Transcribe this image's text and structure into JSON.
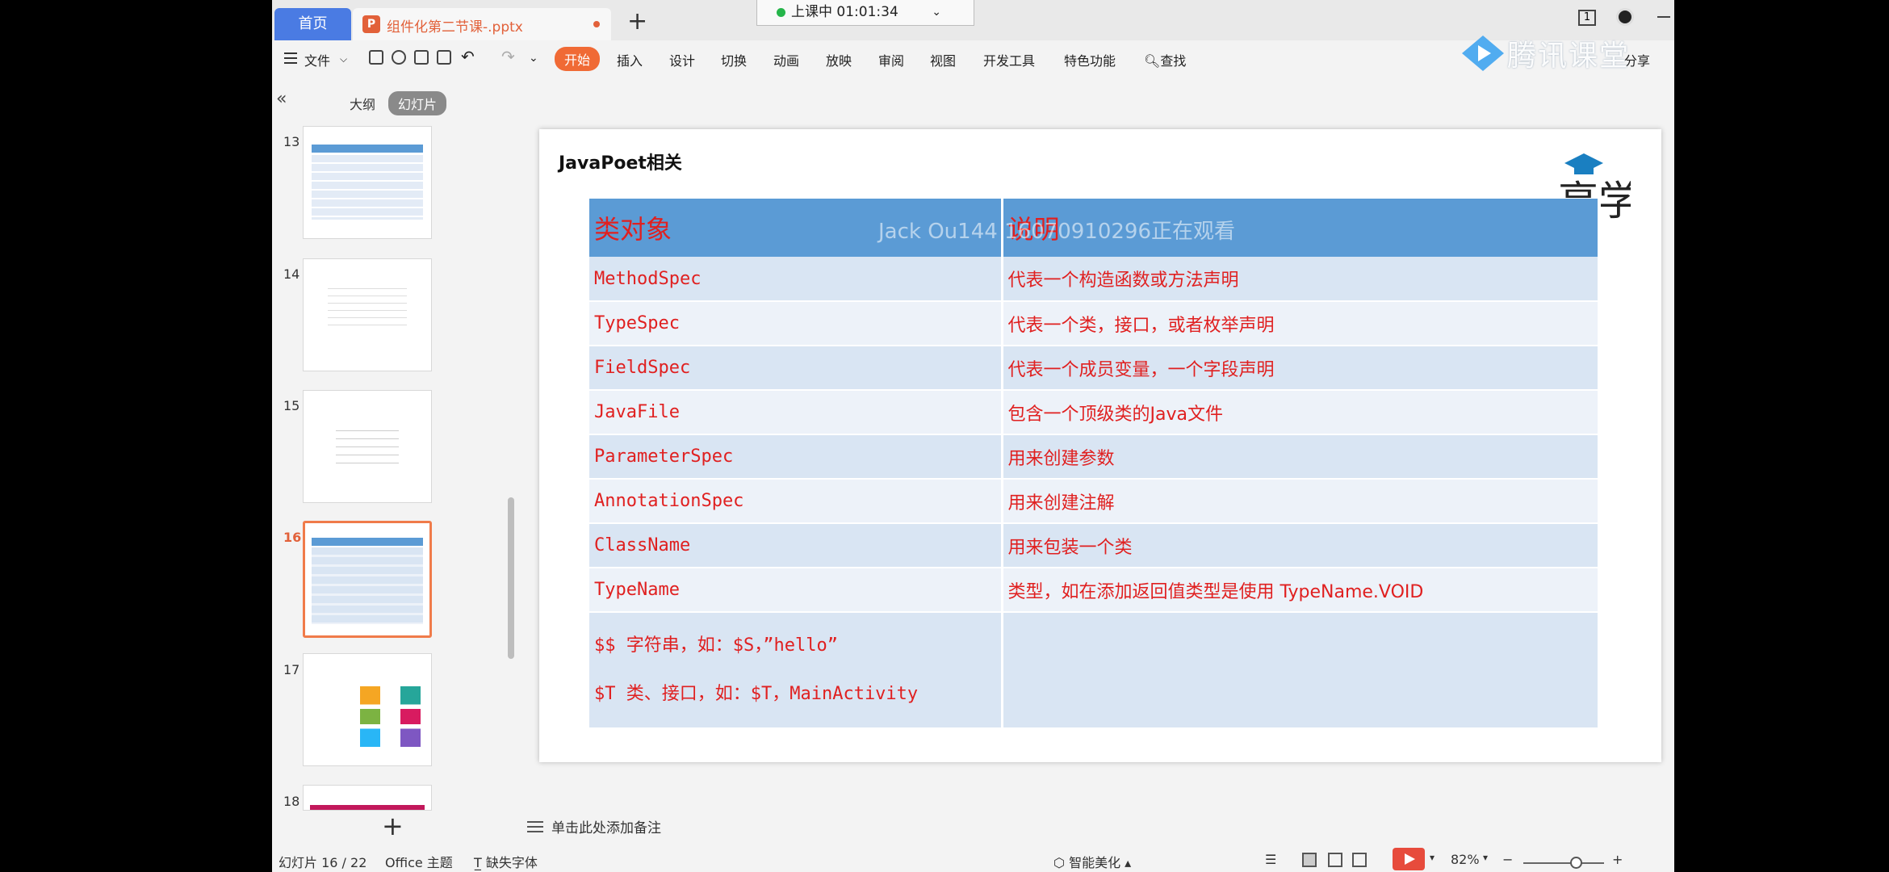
{
  "tabs": {
    "home": "首页",
    "document": "组件化第二节课-.pptx",
    "add": "+"
  },
  "live": {
    "status": "上课中 01:01:34",
    "chevron": "⌄"
  },
  "window": {
    "badge": "1"
  },
  "menu": {
    "file": "文件",
    "items": [
      "开始",
      "插入",
      "设计",
      "切换",
      "动画",
      "放映",
      "审阅",
      "视图",
      "开发工具",
      "特色功能"
    ],
    "search": "查找",
    "share": "分享",
    "watermark": "腾讯课堂"
  },
  "sidebar": {
    "outline": "大纲",
    "slides": "幻灯片",
    "thumbs": [
      "13",
      "14",
      "15",
      "16",
      "17",
      "18"
    ],
    "current": "16"
  },
  "slide": {
    "title": "JavaPoet相关",
    "viewer_watermark": "Jack Ou144   16070910296正在观看",
    "table": {
      "headers": [
        "类对象",
        "说明"
      ],
      "rows": [
        [
          "MethodSpec",
          "代表一个构造函数或方法声明"
        ],
        [
          "TypeSpec",
          "代表一个类，接口，或者枚举声明"
        ],
        [
          "FieldSpec",
          "代表一个成员变量，一个字段声明"
        ],
        [
          "JavaFile",
          "包含一个顶级类的Java文件"
        ],
        [
          "ParameterSpec",
          "用来创建参数"
        ],
        [
          "AnnotationSpec",
          "用来创建注解"
        ],
        [
          "ClassName",
          "用来包装一个类"
        ],
        [
          "TypeName",
          "类型，如在添加返回值类型是使用 TypeName.VOID"
        ]
      ],
      "last_row": [
        "$$ 字符串，如：$S，”hello”",
        "$T 类、接口，如：$T，MainActivity"
      ]
    }
  },
  "notes_placeholder": "单击此处添加备注",
  "status": {
    "slide_pos": "幻灯片 16 / 22",
    "theme": "Office 主题",
    "font_missing": "缺失字体",
    "beautify": "智能美化",
    "zoom": "82%"
  },
  "colors": {
    "accent": "#f06a35",
    "header_blue": "#5b9bd5",
    "table_text": "#e02020"
  }
}
